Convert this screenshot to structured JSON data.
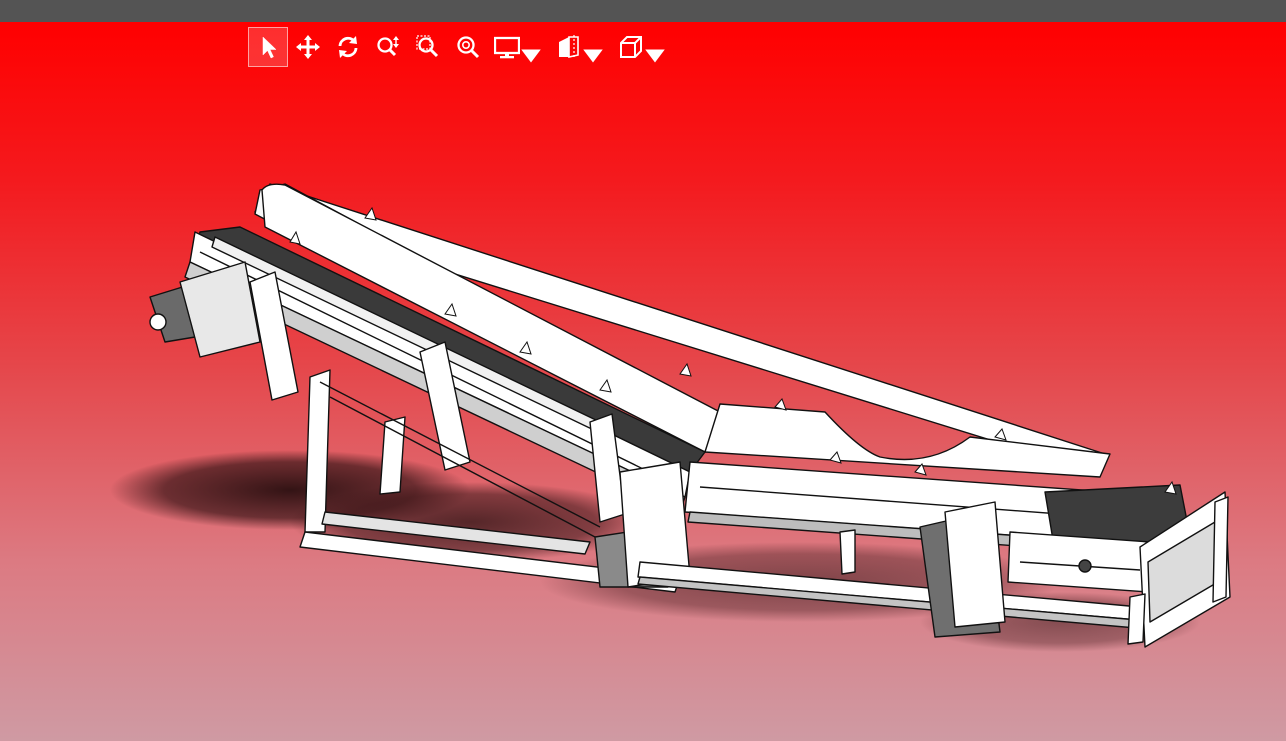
{
  "app": {
    "titlebar_color": "#545454",
    "background_top": "#ff0000",
    "background_bottom": "#cf9aa3"
  },
  "toolbar": {
    "tools": [
      {
        "id": "select",
        "icon": "select-arrow-icon",
        "active": true
      },
      {
        "id": "pan",
        "icon": "pan-icon",
        "active": false
      },
      {
        "id": "rotate",
        "icon": "rotate-icon",
        "active": false
      },
      {
        "id": "zoom",
        "icon": "zoom-updown-icon",
        "active": false
      },
      {
        "id": "zoom-window",
        "icon": "zoom-window-icon",
        "active": false
      },
      {
        "id": "zoom-fit",
        "icon": "zoom-fit-icon",
        "active": false
      },
      {
        "id": "display",
        "icon": "monitor-icon",
        "dropdown": true
      },
      {
        "id": "section",
        "icon": "section-view-icon",
        "dropdown": true
      },
      {
        "id": "view-orientation",
        "icon": "cube-view-icon",
        "dropdown": true
      }
    ]
  },
  "model": {
    "description_icon": "conveyor-3d-model"
  }
}
